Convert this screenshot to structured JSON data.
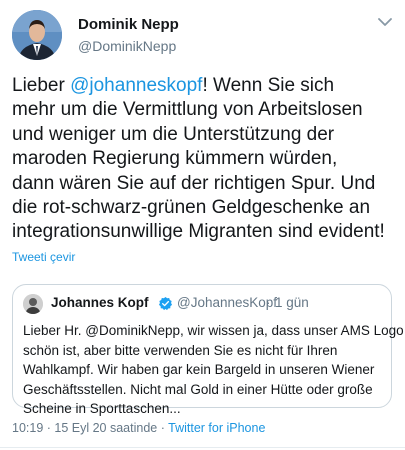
{
  "author": {
    "name": "Dominik Nepp",
    "handle": "@DominikNepp"
  },
  "tweet": {
    "prefix": "Lieber ",
    "mention": "@johanneskopf",
    "lines": [
      "! Wenn Sie sich",
      "mehr um die Vermittlung von Arbeitslosen",
      "und weniger um die Unterstützung der",
      "maroden Regierung kümmern würden,",
      "dann wären Sie auf der richtigen Spur. Und",
      "die rot-schwarz-grünen Geldgeschenke an",
      "integrationsunwillige Migranten sind evident!"
    ],
    "translate_label": "Tweeti çevir"
  },
  "quoted": {
    "name": "Johannes Kopf",
    "handle": "@JohannesKopf",
    "separator": "·",
    "time": "1 gün",
    "lines": [
      "Lieber Hr. @DominikNepp, wir wissen ja, dass unser AMS Logo",
      "schön ist, aber bitte verwenden Sie es nicht für Ihren",
      "Wahlkampf. Wir haben gar kein Bargeld in unseren Wiener",
      "Geschäftsstellen. Nicht mal Gold in einer Hütte oder große",
      "Scheine in Sporttaschen..."
    ]
  },
  "meta": {
    "time": "10:19",
    "date": " · 15 Eyl 20 saatinde · ",
    "source": "Twitter for iPhone"
  },
  "icons": {
    "more": "chevron-down-icon",
    "verified": "verified-badge-icon"
  },
  "colors": {
    "link": "#1b95e0",
    "secondary": "#657786",
    "verified": "#1da1f2"
  }
}
